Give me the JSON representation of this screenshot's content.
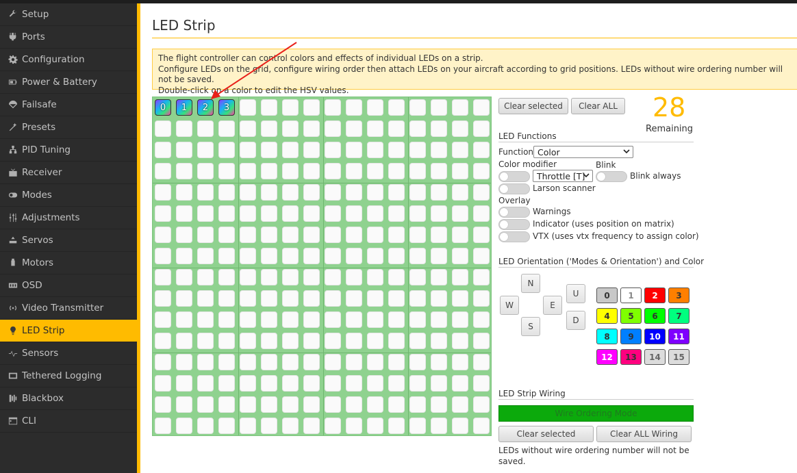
{
  "sidebar": {
    "items": [
      {
        "label": "Setup",
        "icon": "wrench-icon"
      },
      {
        "label": "Ports",
        "icon": "plug-icon"
      },
      {
        "label": "Configuration",
        "icon": "gear-icon"
      },
      {
        "label": "Power & Battery",
        "icon": "battery-icon"
      },
      {
        "label": "Failsafe",
        "icon": "parachute-icon"
      },
      {
        "label": "Presets",
        "icon": "magic-wand-icon"
      },
      {
        "label": "PID Tuning",
        "icon": "hierarchy-icon"
      },
      {
        "label": "Receiver",
        "icon": "receiver-icon"
      },
      {
        "label": "Modes",
        "icon": "toggle-icon"
      },
      {
        "label": "Adjustments",
        "icon": "sliders-icon"
      },
      {
        "label": "Servos",
        "icon": "servo-icon"
      },
      {
        "label": "Motors",
        "icon": "motor-icon"
      },
      {
        "label": "OSD",
        "icon": "osd-icon"
      },
      {
        "label": "Video Transmitter",
        "icon": "broadcast-icon"
      },
      {
        "label": "LED Strip",
        "icon": "bulb-icon"
      },
      {
        "label": "Sensors",
        "icon": "pulse-icon"
      },
      {
        "label": "Tethered Logging",
        "icon": "cable-icon"
      },
      {
        "label": "Blackbox",
        "icon": "blackbox-icon"
      },
      {
        "label": "CLI",
        "icon": "terminal-icon"
      }
    ],
    "active_index": 14
  },
  "page": {
    "title": "LED Strip",
    "note_lines": [
      "The flight controller can control colors and effects of individual LEDs on a strip.",
      "Configure LEDs on the grid, configure wiring order then attach LEDs on your aircraft according to grid positions. LEDs without wire ordering number will not be saved.",
      "Double-click on a color to edit the HSV values."
    ]
  },
  "grid": {
    "rows": 16,
    "cols": 16,
    "leds": [
      {
        "row": 0,
        "col": 0,
        "label": "0"
      },
      {
        "row": 0,
        "col": 1,
        "label": "1"
      },
      {
        "row": 0,
        "col": 2,
        "label": "2"
      },
      {
        "row": 0,
        "col": 3,
        "label": "3"
      }
    ]
  },
  "controls": {
    "clear_selected": "Clear selected",
    "clear_all": "Clear ALL",
    "remaining_count": "28",
    "remaining_label": "Remaining"
  },
  "functions": {
    "header": "LED Functions",
    "function_label": "Function",
    "function_value": "Color",
    "color_modifier_label": "Color modifier",
    "modifier_value": "Throttle [T]",
    "blink_label": "Blink",
    "blink_always": "Blink always",
    "larson": "Larson scanner",
    "overlay_label": "Overlay",
    "warnings": "Warnings",
    "indicator": "Indicator (uses position on matrix)",
    "vtx": "VTX (uses vtx frequency to assign color)"
  },
  "orientation": {
    "header": "LED Orientation ('Modes & Orientation') and Color",
    "directions": {
      "n": "N",
      "e": "E",
      "s": "S",
      "w": "W",
      "u": "U",
      "d": "D"
    },
    "colors": [
      {
        "label": "0",
        "bg": "#c8c8c8",
        "fg": "#333333"
      },
      {
        "label": "1",
        "bg": "#ffffff",
        "fg": "#888888"
      },
      {
        "label": "2",
        "bg": "#ff0000",
        "fg": "#ffffff"
      },
      {
        "label": "3",
        "bg": "#ff7f00",
        "fg": "#333333"
      },
      {
        "label": "4",
        "bg": "#ffff00",
        "fg": "#333333"
      },
      {
        "label": "5",
        "bg": "#7fff00",
        "fg": "#333333"
      },
      {
        "label": "6",
        "bg": "#00ff00",
        "fg": "#333333"
      },
      {
        "label": "7",
        "bg": "#00ff7f",
        "fg": "#333333"
      },
      {
        "label": "8",
        "bg": "#00ffff",
        "fg": "#333333"
      },
      {
        "label": "9",
        "bg": "#007fff",
        "fg": "#333333"
      },
      {
        "label": "10",
        "bg": "#0000ff",
        "fg": "#ffffff"
      },
      {
        "label": "11",
        "bg": "#7f00ff",
        "fg": "#ffffff"
      },
      {
        "label": "12",
        "bg": "#ff00ff",
        "fg": "#ffffff"
      },
      {
        "label": "13",
        "bg": "#ff007f",
        "fg": "#333333"
      },
      {
        "label": "14",
        "bg": "#dcdcdc",
        "fg": "#666666"
      },
      {
        "label": "15",
        "bg": "#dcdcdc",
        "fg": "#666666"
      }
    ]
  },
  "wiring": {
    "header": "LED Strip Wiring",
    "mode_button": "Wire Ordering Mode",
    "clear_selected": "Clear selected",
    "clear_all_wiring": "Clear ALL Wiring",
    "note": "LEDs without wire ordering number will not be saved."
  }
}
